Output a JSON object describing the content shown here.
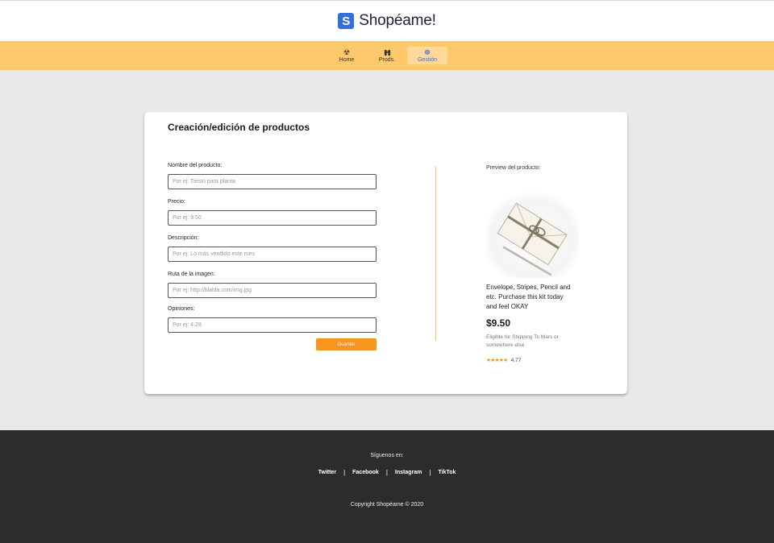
{
  "header": {
    "logo_letter": "S",
    "brand": "Shopéame!"
  },
  "nav": {
    "items": [
      {
        "label": "Home",
        "icon": "radioactive-icon",
        "active": false
      },
      {
        "label": "Prods.",
        "icon": "binoculars-icon",
        "active": false
      },
      {
        "label": "Gestión",
        "icon": "ship-wheel-icon",
        "active": true
      }
    ]
  },
  "form": {
    "title": "Creación/edición de productos",
    "fields": [
      {
        "label": "Nombre del producto:",
        "placeholder": "Por ej: Tiesto para planta"
      },
      {
        "label": "Precio:",
        "placeholder": "Por ej: 9.50"
      },
      {
        "label": "Descripción:",
        "placeholder": "Por ej: Lo más vendido este mes"
      },
      {
        "label": "Ruta de la imagen:",
        "placeholder": "Por ej: http://blabla.com/img.jpg"
      },
      {
        "label": "Opiniones:",
        "placeholder": "Por ej: 4.28"
      }
    ],
    "save_label": "Guardar"
  },
  "preview": {
    "label": "Preview del producto:",
    "name": "Envelope, Stripes, Pencil and etc. Purchase this kit today and feel OKAY",
    "price": "$9.50",
    "shipping": "Eligible for Shipping To Mars or somewhere else",
    "stars": "★★★★★",
    "rating": "4.77",
    "image_icon": "envelope-pencil-image"
  },
  "footer": {
    "follow": "Síguenos en:",
    "links": [
      "Twitter",
      "Facebook",
      "Instagram",
      "TikTok"
    ],
    "separator": "|",
    "copyright": "Copyright Shopéame © 2020"
  },
  "colors": {
    "nav_bg": "#ffc86a",
    "accent": "#f7961e",
    "brand_blue": "#2f6fe0",
    "footer_bg": "#2c2c2c"
  }
}
